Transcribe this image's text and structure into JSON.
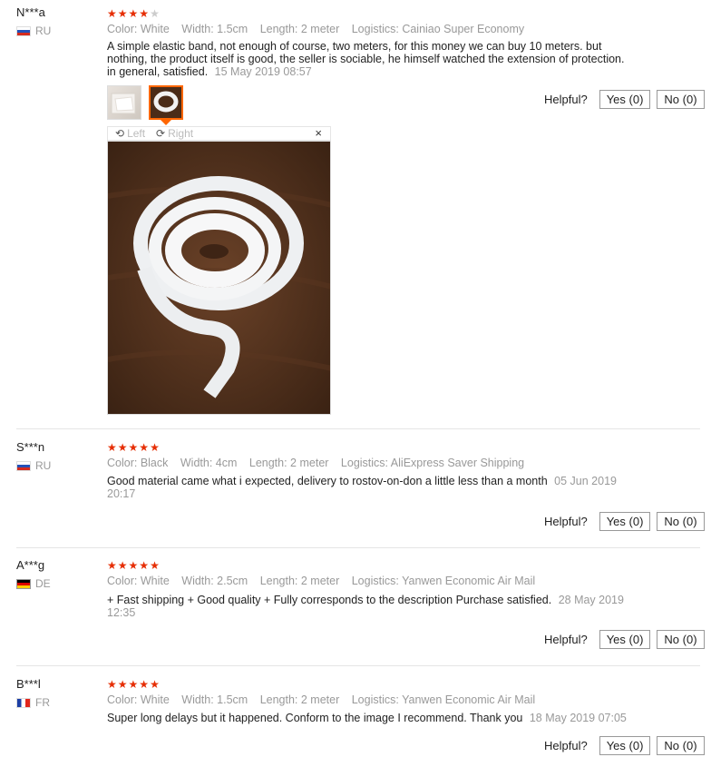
{
  "reviews": [
    {
      "user": "N***a",
      "country": "RU",
      "rating": 4,
      "color": "Color: White",
      "width": "Width: 1.5cm",
      "length": "Length: 2 meter",
      "logistics": "Logistics: Cainiao Super Economy",
      "text": "A simple elastic band, not enough of course, two meters, for this money we can buy 10 meters. but nothing, the product itself is good, the seller is sociable, he himself watched the extension of protection. in general, satisfied.",
      "date": "15 May 2019 08:57",
      "helpful_label": "Helpful?",
      "yes_label": "Yes (0)",
      "no_label": "No (0)"
    },
    {
      "user": "S***n",
      "country": "RU",
      "rating": 5,
      "color": "Color: Black",
      "width": "Width: 4cm",
      "length": "Length: 2 meter",
      "logistics": "Logistics: AliExpress Saver Shipping",
      "text": "Good material came what i expected, delivery to rostov-on-don a little less than a month",
      "date": "05 Jun 2019 20:17",
      "helpful_label": "Helpful?",
      "yes_label": "Yes (0)",
      "no_label": "No (0)"
    },
    {
      "user": "A***g",
      "country": "DE",
      "rating": 5,
      "color": "Color: White",
      "width": "Width: 2.5cm",
      "length": "Length: 2 meter",
      "logistics": "Logistics: Yanwen Economic Air Mail",
      "text": "+ Fast shipping + Good quality + Fully corresponds to the description Purchase satisfied.",
      "date": "28 May 2019 12:35",
      "helpful_label": "Helpful?",
      "yes_label": "Yes (0)",
      "no_label": "No (0)"
    },
    {
      "user": "B***l",
      "country": "FR",
      "rating": 5,
      "color": "Color: White",
      "width": "Width: 1.5cm",
      "length": "Length: 2 meter",
      "logistics": "Logistics: Yanwen Economic Air Mail",
      "text": "Super long delays but it happened. Conform to the image I recommend. Thank you",
      "date": "18 May 2019 07:05",
      "helpful_label": "Helpful?",
      "yes_label": "Yes (0)",
      "no_label": "No (0)"
    }
  ],
  "viewer": {
    "left_label": "Left",
    "right_label": "Right",
    "close_label": "×"
  },
  "colors": {
    "star": "#e62e04",
    "meta": "#999999",
    "thumb_active": "#ff6600"
  }
}
